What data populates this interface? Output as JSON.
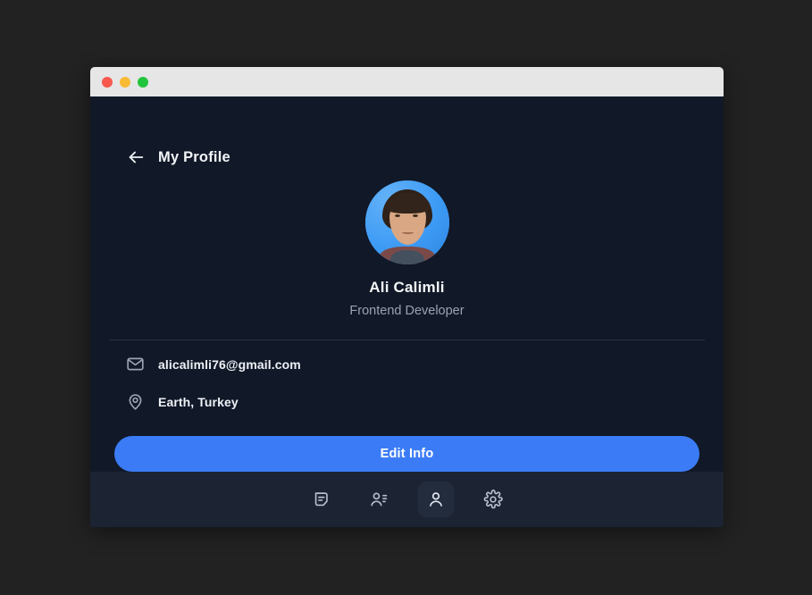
{
  "window": {
    "titlebar": {
      "dots": [
        {
          "name": "close-dot",
          "color": "#f9584e"
        },
        {
          "name": "minimize-dot",
          "color": "#f9ba34"
        },
        {
          "name": "maximize-dot",
          "color": "#21c53c"
        }
      ]
    }
  },
  "header": {
    "back_icon": "arrow-left-icon",
    "title": "My Profile"
  },
  "profile": {
    "avatar_alt": "Ali Calimli profile photo",
    "name": "Ali Calimli",
    "role": "Frontend Developer"
  },
  "info": [
    {
      "icon": "mail-icon",
      "value": "alicalimli76@gmail.com"
    },
    {
      "icon": "map-pin-icon",
      "value": "Earth, Turkey"
    }
  ],
  "actions": {
    "edit_label": "Edit Info"
  },
  "bottom_nav": {
    "items": [
      {
        "id": "messages",
        "icon": "message-icon",
        "active": false
      },
      {
        "id": "contacts",
        "icon": "contacts-icon",
        "active": false
      },
      {
        "id": "profile",
        "icon": "person-icon",
        "active": true
      },
      {
        "id": "settings",
        "icon": "gear-icon",
        "active": false
      }
    ]
  },
  "colors": {
    "accent": "#3b7cf6",
    "page_bg": "#111827",
    "nav_bg": "#1c2433",
    "desktop_bg": "#222222",
    "titlebar_bg": "#e6e6e7",
    "text_primary": "#f2f4f8",
    "text_muted": "#9aa3b2"
  }
}
